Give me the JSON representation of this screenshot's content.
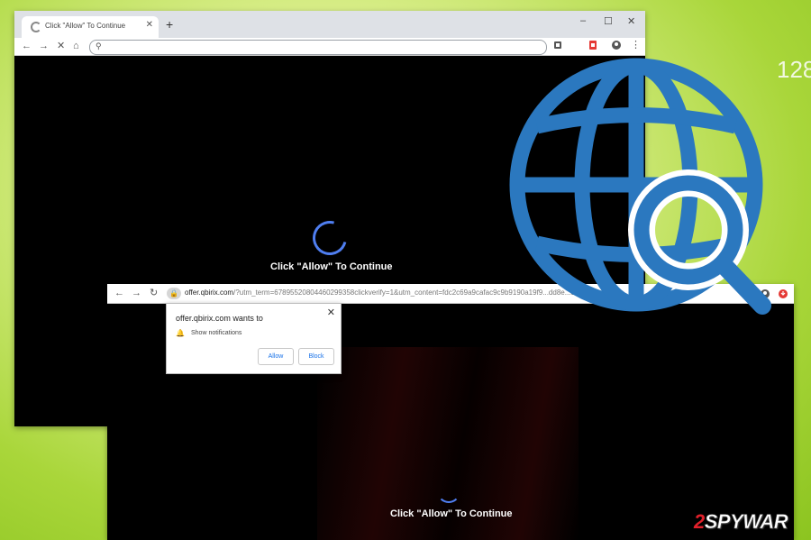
{
  "colors": {
    "accent_blue": "#2b78bf",
    "spinner_blue": "#4f7ef0",
    "brand_red": "#e0202a"
  },
  "back_window": {
    "tab_title": "Click \"Allow\" To Continue",
    "new_tab": "+",
    "icons": [
      "back-arrow-icon",
      "forward-arrow-icon",
      "stop-icon",
      "home-icon",
      "search-icon",
      "translate-icon",
      "extension-icon",
      "profile-icon",
      "menu-icon"
    ],
    "page_message": "Click \"Allow\" To Continue"
  },
  "front_window": {
    "url_host": "offer.qbirix.com",
    "url_path": "/?utm_term=67895520804460299358clickverify=1&utm_content=fdc2c69a9cafac9c9b9190a19f9...dd8e...88b08de...be...",
    "popup": {
      "title": "offer.qbirix.com wants to",
      "permission": "Show notifications",
      "allow_label": "Allow",
      "block_label": "Block"
    },
    "page_message": "Click \"Allow\" To Continue"
  },
  "side_number": "128",
  "watermark": {
    "two": "2",
    "rest": "SPYWAR"
  }
}
